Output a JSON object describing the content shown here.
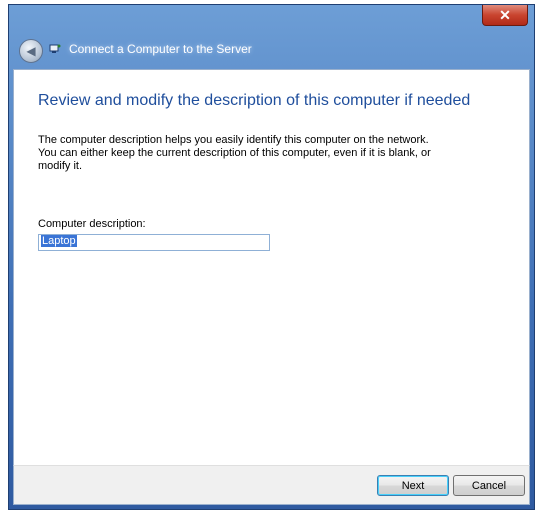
{
  "window": {
    "close_glyph": "✕"
  },
  "nav": {
    "back_glyph": "◀",
    "title": "Connect a Computer to the Server"
  },
  "content": {
    "heading": "Review and modify the description of this computer if needed",
    "description_lines": [
      "The computer description helps you easily identify this computer on the network.",
      "You can either keep the current description of this computer, even if it is blank, or",
      "modify it."
    ],
    "field_label": "Computer description:",
    "field_value": "Laptop"
  },
  "footer": {
    "next_label": "Next",
    "cancel_label": "Cancel"
  },
  "colors": {
    "heading": "#1f4e9c",
    "selection": "#3a74d6"
  }
}
